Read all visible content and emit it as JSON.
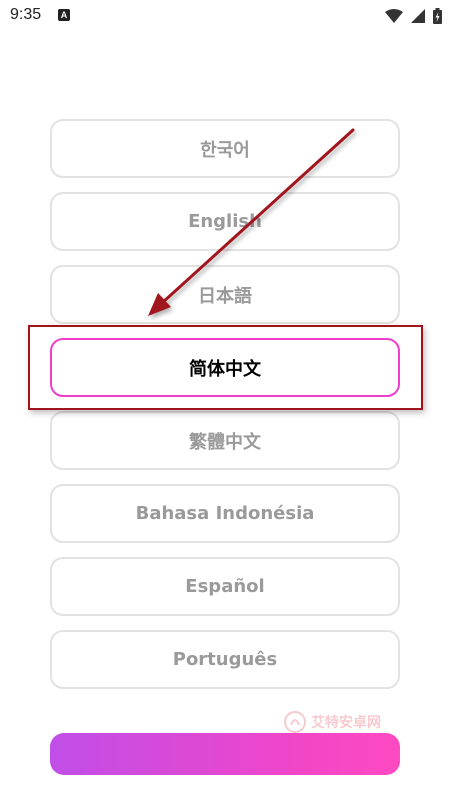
{
  "status_bar": {
    "time": "9:35",
    "notification_icon_label": "A",
    "icons": [
      "wifi-icon",
      "signal-icon",
      "battery-icon"
    ]
  },
  "languages": [
    {
      "label": "한국어",
      "selected": false
    },
    {
      "label": "English",
      "selected": false
    },
    {
      "label": "日本語",
      "selected": false
    },
    {
      "label": "简体中文",
      "selected": true
    },
    {
      "label": "繁體中文",
      "selected": false
    },
    {
      "label": "Bahasa Indonésia",
      "selected": false
    },
    {
      "label": "Español",
      "selected": false
    },
    {
      "label": "Português",
      "selected": false
    }
  ],
  "watermark": {
    "text": "艾特安卓网"
  },
  "confirm_button": {
    "label": ""
  },
  "colors": {
    "selected_border": "#ee3ecb",
    "unselected_border": "#e2e2e2",
    "unselected_text": "#9a9a9a",
    "annotation_red": "#a0141e",
    "button_gradient_start": "#c04ee8",
    "button_gradient_end": "#ff4ac2"
  }
}
